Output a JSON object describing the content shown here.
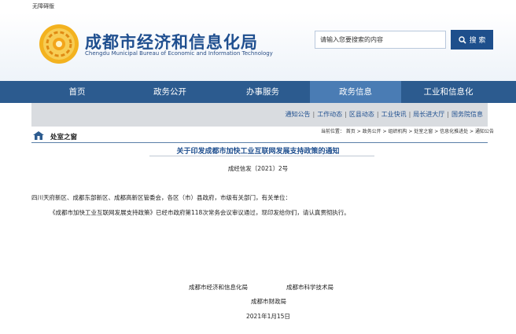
{
  "accessibility": "无障碍版",
  "site": {
    "name_cn": "成都市经济和信息化局",
    "name_en": "Chengdu Municipal Bureau of Economic and Information Technology"
  },
  "search": {
    "value": "请输入您要搜索的内容",
    "button": "搜 索"
  },
  "nav": [
    "首页",
    "政务公开",
    "办事服务",
    "政务信息",
    "工业和信息化"
  ],
  "subnav": [
    "通知公告",
    "工作动态",
    "区县动态",
    "工业快讯",
    "局长进大厅",
    "国务院信息"
  ],
  "breadcrumb": "当前位置： 首页 > 政务公开 > 组织机构 > 处室之窗 > 信息化推进处 > 通知公告",
  "section_label": "处室之窗",
  "article": {
    "title": "关于印发成都市加快工业互联网发展支持政策的通知",
    "doc_number": "成经信发〔2021〕2号",
    "recipients": "四川天府新区、成都东部新区、成都高新区管委会，各区（市）县政府，市级有关部门，有关单位：",
    "body": "《成都市加快工业互联网发展支持政策》已经市政府第118次常务会议审议通过，现印发给你们，请认真贯彻执行。",
    "signer1": "成都市经济和信息化局",
    "signer2": "成都市科学技术局",
    "signer3": "成都市财政局",
    "date": "2021年1月15日"
  },
  "colors": {
    "nav_bg": "#2c5b8f",
    "nav_active": "#4a7cb4",
    "brand_blue": "#1f4f8f",
    "subnav_bg": "#d9dce0"
  }
}
